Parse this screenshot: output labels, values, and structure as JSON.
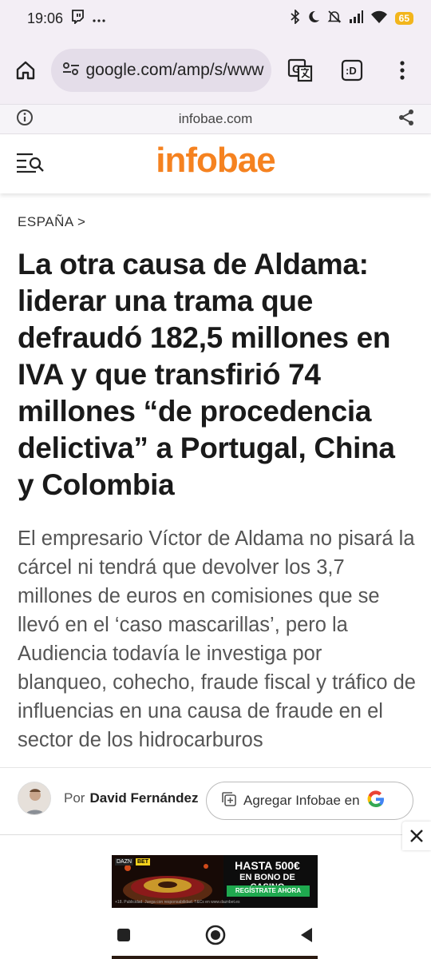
{
  "status_bar": {
    "time": "19:06",
    "battery": "65",
    "icons": [
      "twitch-icon",
      "more-icon",
      "bluetooth-icon",
      "moon-icon",
      "mute-icon",
      "signal-icon",
      "wifi-icon",
      "battery-icon"
    ]
  },
  "browser": {
    "url": "google.com/amp/s/www",
    "amp_domain": "infobae.com",
    "tab_label": ":D"
  },
  "site": {
    "logo": "infobae",
    "logo_color": "#f58220"
  },
  "article": {
    "section": "ESPAÑA >",
    "headline": "La otra causa de Aldama: liderar una trama que defraudó 182,5 millones en IVA y que transfirió 74 millones “de procedencia delictiva” a Portugal, China y Colombia",
    "summary": "El empresario Víctor de Aldama no pisará la cárcel ni tendrá que devolver los 3,7 millones de euros en comisiones que se llevó en el ‘caso mascarillas’, pero la Audiencia todavía le investiga por blanqueo, cohecho, fraude fiscal y tráfico de influencias en una causa de fraude en el sector de los hidrocarburos",
    "by_label": "Por",
    "author": "David Fernández",
    "google_button": "Agregar Infobae en"
  },
  "ad": {
    "headline": "HASTA 500€",
    "sub": "EN BONO DE CASINO",
    "cta": "REGÍSTRATE AHORA",
    "brand": "DAZN",
    "brand2": "BET",
    "fine_print": "+18. Publicidad. Juega con responsabilidad. T&Cs en www.daznbet.es"
  }
}
